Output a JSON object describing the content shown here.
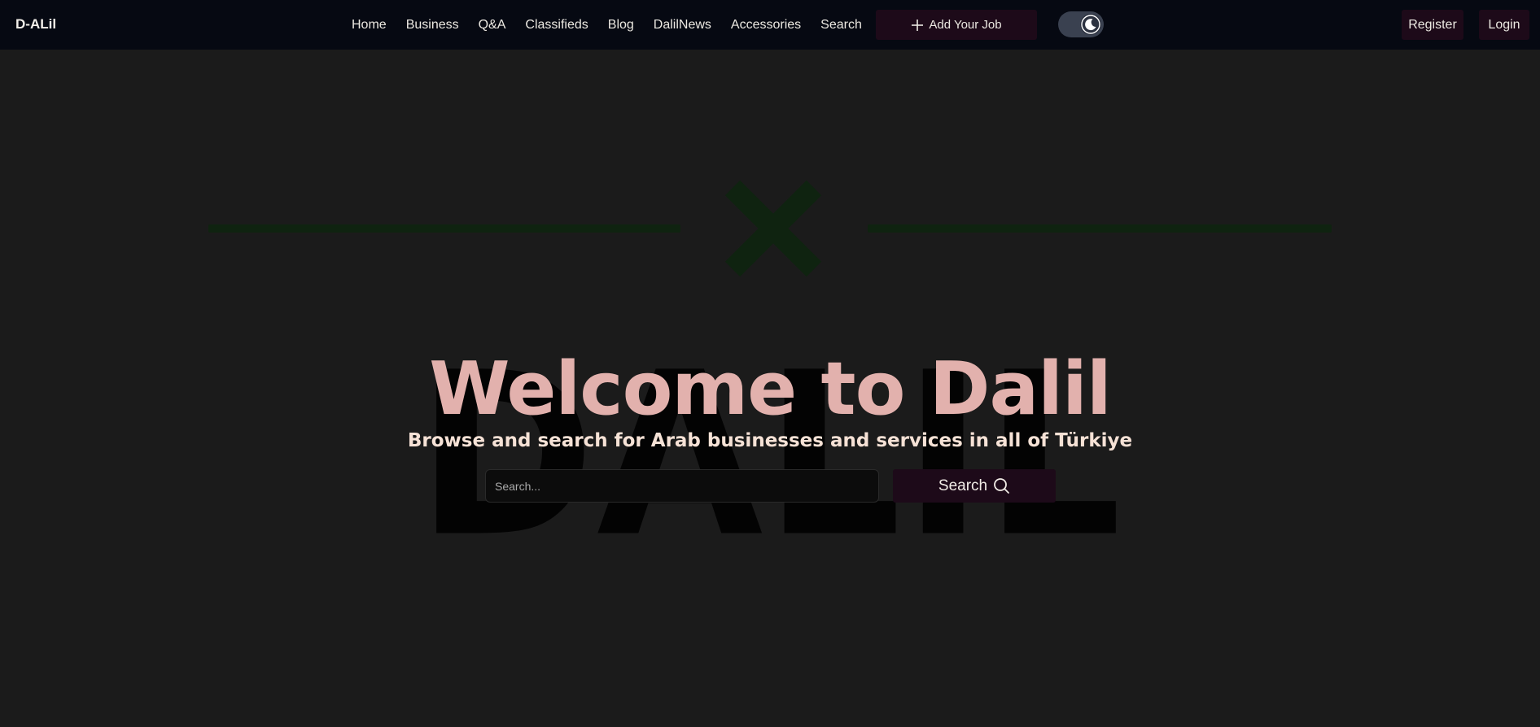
{
  "navbar": {
    "brand": "D-ALil",
    "links": [
      {
        "label": "Home"
      },
      {
        "label": "Business"
      },
      {
        "label": "Q&A"
      },
      {
        "label": "Classifieds"
      },
      {
        "label": "Blog"
      },
      {
        "label": "DalilNews"
      },
      {
        "label": "Accessories"
      },
      {
        "label": "Search"
      }
    ],
    "add_job_label": "Add Your Job",
    "add_job_icon": "plus-icon",
    "theme_toggle_icon": "moon-icon",
    "register_label": "Register",
    "login_label": "Login"
  },
  "hero": {
    "watermark": "DALIL",
    "title": "Welcome to Dalil",
    "subtitle": "Browse and search for Arab businesses and services in all of Türkiye",
    "search": {
      "placeholder": "Search...",
      "value": "",
      "button_label": "Search",
      "button_icon": "search-icon"
    },
    "decoration_icon": "close-x-icon"
  },
  "colors": {
    "background": "#1b1b1b",
    "navbar": "#060912",
    "accent_button": "#1d0a19",
    "title": "#e2b1ad",
    "subtitle": "#f6e2d6",
    "decoration_green": "#0f2310",
    "toggle_track": "#3a4150"
  }
}
